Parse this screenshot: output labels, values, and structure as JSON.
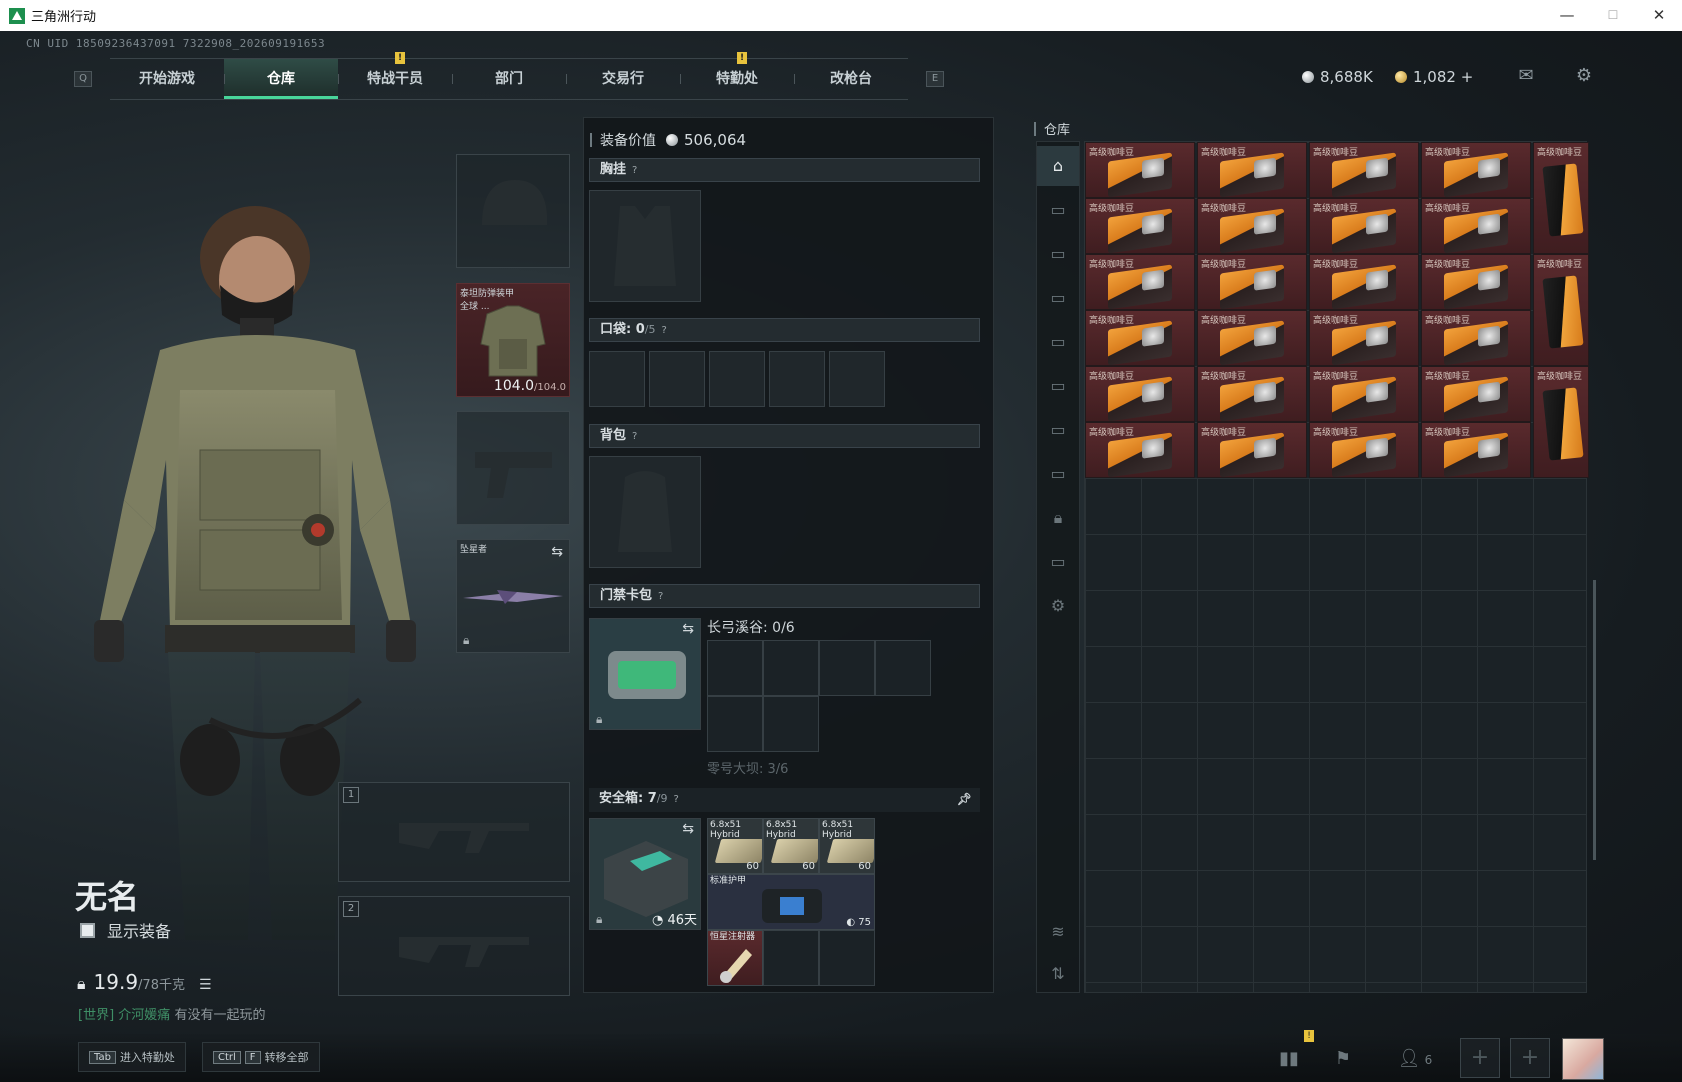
{
  "window": {
    "title": "三角洲行动",
    "minimize": "—",
    "maximize": "☐",
    "close": "✕"
  },
  "uid": "CN UID 18509236437091 7322908_202609191653",
  "nav": {
    "left_key": "Q",
    "right_key": "E",
    "tabs": [
      {
        "label": "开始游戏"
      },
      {
        "label": "仓库"
      },
      {
        "label": "特战干员"
      },
      {
        "label": "部门"
      },
      {
        "label": "交易行"
      },
      {
        "label": "特勤处"
      },
      {
        "label": "改枪台"
      }
    ],
    "active_tab": "仓库"
  },
  "currency": {
    "silver": "8,688K",
    "gold": "1,082 +"
  },
  "character": {
    "name": "无名",
    "show_gear_label": "显示装备",
    "weight": "19.9",
    "weight_max": "/78千克",
    "chat_channel": "[世界]",
    "chat_user": "介河媛痛",
    "chat_text": "有没有一起玩的"
  },
  "equipment": {
    "armor_label": "泰坦防弹装甲\n全球 ...",
    "armor_durability": "104.0",
    "armor_max": "/104.0",
    "melee_label": "坠星者",
    "weapon_slot_1": "1",
    "weapon_slot_2": "2"
  },
  "loadout": {
    "value_label": "装备价值",
    "value": "506,064",
    "chest_rig_label": "胸挂",
    "pocket_label": "口袋:",
    "pocket_count": "0",
    "pocket_max": "/5",
    "backpack_label": "背包",
    "keycard_label": "门禁卡包",
    "keybag_title": "长弓溪谷: 0/6",
    "keybag_sub": "零号大坝: 3/6",
    "safe_label": "安全箱:",
    "safe_count": "7",
    "safe_max": "/9",
    "safe_days": "46天",
    "safe_items": [
      {
        "name": "6.8x51\nHybrid",
        "count": "60"
      },
      {
        "name": "6.8x51\nHybrid",
        "count": "60"
      },
      {
        "name": "6.8x51\nHybrid",
        "count": "60"
      }
    ],
    "armor_kit_label": "标准护甲",
    "armor_kit_count": "75",
    "injector_label": "恒星注射器"
  },
  "warehouse": {
    "title": "仓库",
    "item_label": "高级咖啡豆"
  },
  "bottom": {
    "hint1_key": "Tab",
    "hint1_label": "进入特勤处",
    "hint2_key1": "Ctrl",
    "hint2_key2": "F",
    "hint2_label": "转移全部",
    "friends_count": "6"
  },
  "colors": {
    "accent": "#48d59a",
    "alert": "#e8c33d",
    "item_rarity_red": "#5a2a2d"
  }
}
